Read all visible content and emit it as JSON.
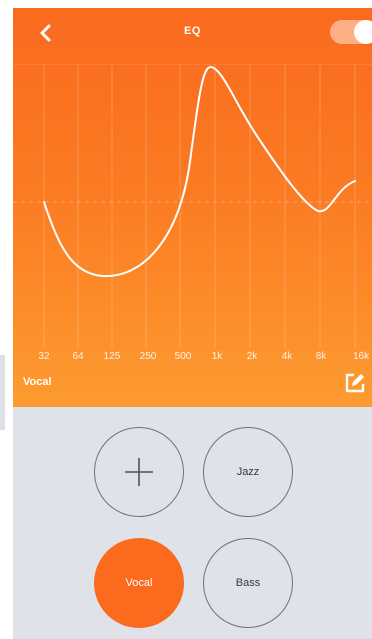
{
  "header": {
    "title": "EQ",
    "toggle_on": true
  },
  "eq": {
    "frequencies": [
      "32",
      "64",
      "125",
      "250",
      "500",
      "1k",
      "2k",
      "4k",
      "8k",
      "16k Hz"
    ],
    "active_preset_name": "Vocal"
  },
  "presets": {
    "buttons": [
      "Jazz",
      "Vocal",
      "Bass"
    ],
    "active": "Vocal"
  },
  "colors": {
    "accent": "#fb6a1d",
    "gradient_top": "#fa6a1f",
    "gradient_bottom": "#fd9b30",
    "panel_bg": "#dfe3e9"
  },
  "icons": {
    "back": "chevron-left-icon",
    "add": "plus-icon",
    "edit": "edit-icon"
  }
}
